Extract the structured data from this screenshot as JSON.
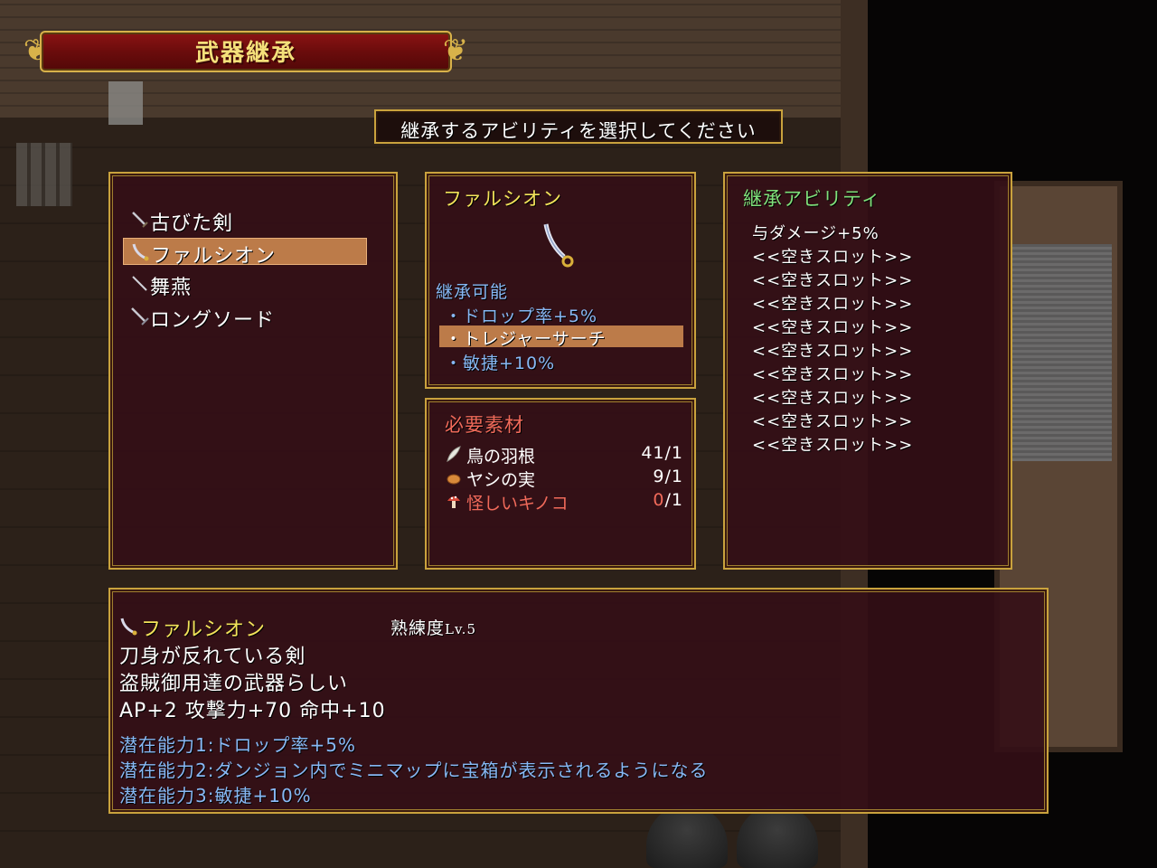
{
  "screen_title": "武器継承",
  "instruction": "継承するアビリティを選択してください",
  "weapon_list": {
    "items": [
      {
        "label": "古びた剣",
        "icon": "sword-icon",
        "selected": false
      },
      {
        "label": "ファルシオン",
        "icon": "falchion-icon",
        "selected": true
      },
      {
        "label": "舞燕",
        "icon": "sword-icon",
        "selected": false
      },
      {
        "label": "ロングソード",
        "icon": "longsword-icon",
        "selected": false
      }
    ]
  },
  "weapon_detail": {
    "name": "ファルシオン",
    "inheritable_header": "継承可能",
    "abilities": [
      {
        "label": "・ドロップ率+5%",
        "selected": false
      },
      {
        "label": "・トレジャーサーチ",
        "selected": true
      },
      {
        "label": "・敏捷+10%",
        "selected": false
      }
    ]
  },
  "materials": {
    "header": "必要素材",
    "items": [
      {
        "name": "鳥の羽根",
        "have": "41",
        "need": "1",
        "icon": "feather-icon",
        "insufficient": false
      },
      {
        "name": "ヤシの実",
        "have": "9",
        "need": "1",
        "icon": "coconut-icon",
        "insufficient": false
      },
      {
        "name": "怪しいキノコ",
        "have": "0",
        "need": "1",
        "icon": "mushroom-icon",
        "insufficient": true
      }
    ]
  },
  "inherited_abilities": {
    "header": "継承アビリティ",
    "slots": [
      "与ダメージ+5%",
      "<<空きスロット>>",
      "<<空きスロット>>",
      "<<空きスロット>>",
      "<<空きスロット>>",
      "<<空きスロット>>",
      "<<空きスロット>>",
      "<<空きスロット>>",
      "<<空きスロット>>",
      "<<空きスロット>>"
    ]
  },
  "description": {
    "weapon_name": "ファルシオン",
    "proficiency_label": "熟練度",
    "proficiency_level": "Lv.5",
    "lines": [
      "刀身が反れている剣",
      "盗賊御用達の武器らしい",
      "AP+2 攻撃力+70 命中+10"
    ],
    "potentials": [
      "潜在能力1:ドロップ率+5%",
      "潜在能力2:ダンジョン内でミニマップに宝箱が表示されるようになる",
      "潜在能力3:敏捷+10%"
    ]
  },
  "colors": {
    "window_bg": "#340e16",
    "border_gold": "#c9a23d",
    "highlight": "#d58e52",
    "yellow_text": "#f2e35a",
    "blue_text": "#87b8f4",
    "green_text": "#7fe07a",
    "red_text": "#f06a5a"
  }
}
